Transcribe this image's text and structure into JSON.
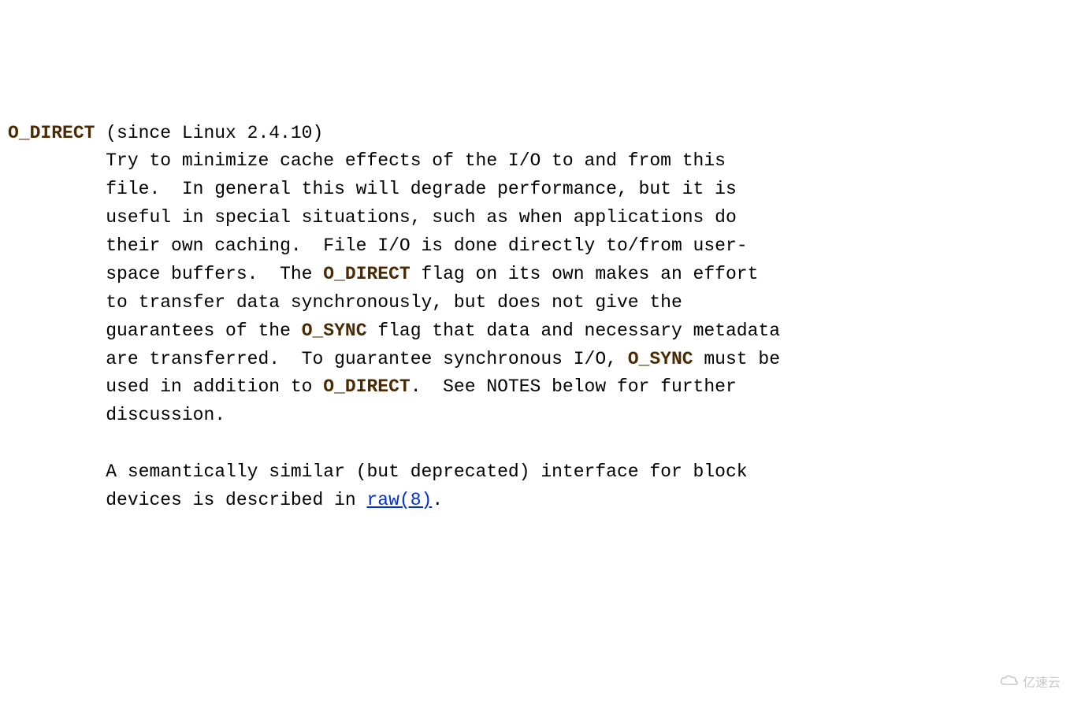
{
  "term": "O_DIRECT",
  "since": " (since Linux 2.4.10)",
  "p1a": "Try to minimize cache effects of the I/O to and from this\n         file.  In general this will degrade performance, but it is\n         useful in special situations, such as when applications do\n         their own caching.  File I/O is done directly to/from user-\n         space buffers.  The ",
  "k1": "O_DIRECT",
  "p1b": " flag on its own makes an effort\n         to transfer data synchronously, but does not give the\n         guarantees of the ",
  "k2": "O_SYNC",
  "p1c": " flag that data and necessary metadata\n         are transferred.  To guarantee synchronous I/O, ",
  "k3": "O_SYNC",
  "p1d": " must be\n         used in addition to ",
  "k4": "O_DIRECT",
  "p1e": ".  See NOTES below for further\n         discussion.",
  "p2a": "A semantically similar (but deprecated) interface for block\n         devices is described in ",
  "link": "raw(8)",
  "p2b": ".",
  "watermark": "亿速云"
}
